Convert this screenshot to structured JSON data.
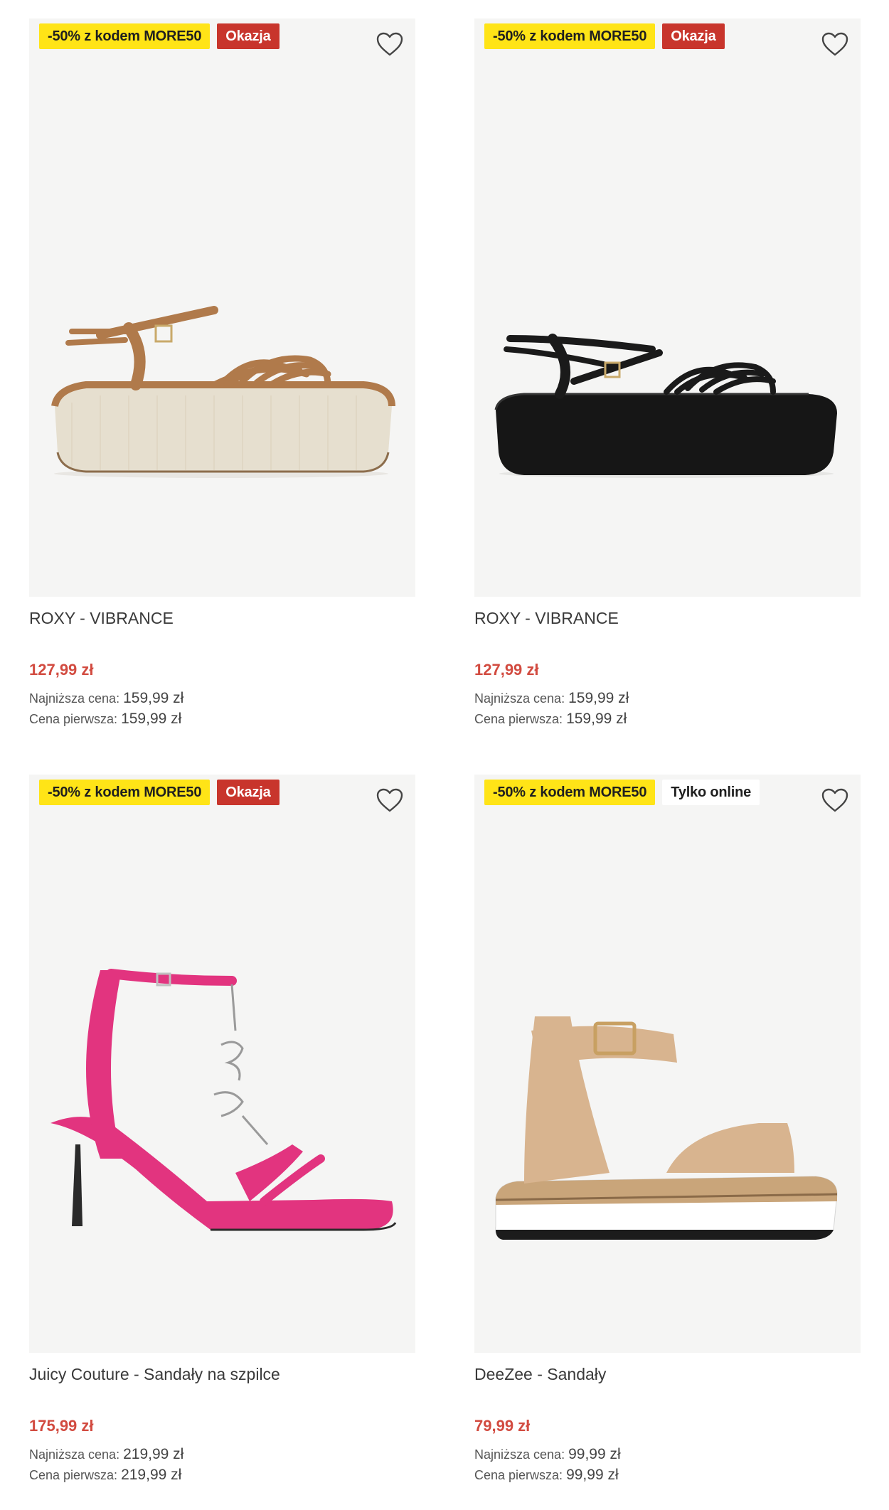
{
  "products": [
    {
      "badge_promo": "-50% z kodem MORE50",
      "badge_secondary": "Okazja",
      "badge_secondary_type": "deal",
      "image_alt": "Brązowe sandały na platformie",
      "name": "ROXY - VIBRANCE",
      "price": "127,99 zł",
      "lowest_label": "Najniższa cena:",
      "lowest_value": "159,99 zł",
      "first_label": "Cena pierwsza:",
      "first_value": "159,99 zł"
    },
    {
      "badge_promo": "-50% z kodem MORE50",
      "badge_secondary": "Okazja",
      "badge_secondary_type": "deal",
      "image_alt": "Czarne sandały na platformie",
      "name": "ROXY - VIBRANCE",
      "price": "127,99 zł",
      "lowest_label": "Najniższa cena:",
      "lowest_value": "159,99 zł",
      "first_label": "Cena pierwsza:",
      "first_value": "159,99 zł"
    },
    {
      "badge_promo": "-50% z kodem MORE50",
      "badge_secondary": "Okazja",
      "badge_secondary_type": "deal",
      "image_alt": "Różowe sandały na szpilce",
      "name": "Juicy Couture - Sandały na szpilce",
      "price": "175,99 zł",
      "lowest_label": "Najniższa cena:",
      "lowest_value": "219,99 zł",
      "first_label": "Cena pierwsza:",
      "first_value": "219,99 zł"
    },
    {
      "badge_promo": "-50% z kodem MORE50",
      "badge_secondary": "Tylko online",
      "badge_secondary_type": "online",
      "image_alt": "Beżowe sandały na koturnie",
      "name": "DeeZee - Sandały",
      "price": "79,99 zł",
      "lowest_label": "Najniższa cena:",
      "lowest_value": "99,99 zł",
      "first_label": "Cena pierwsza:",
      "first_value": "99,99 zł"
    }
  ],
  "icons": {
    "wishlist": "heart-outline-icon"
  },
  "colors": {
    "promo_badge": "#ffe417",
    "deal_badge": "#c8352c",
    "price": "#d24b40",
    "image_bg": "#f5f5f4"
  }
}
